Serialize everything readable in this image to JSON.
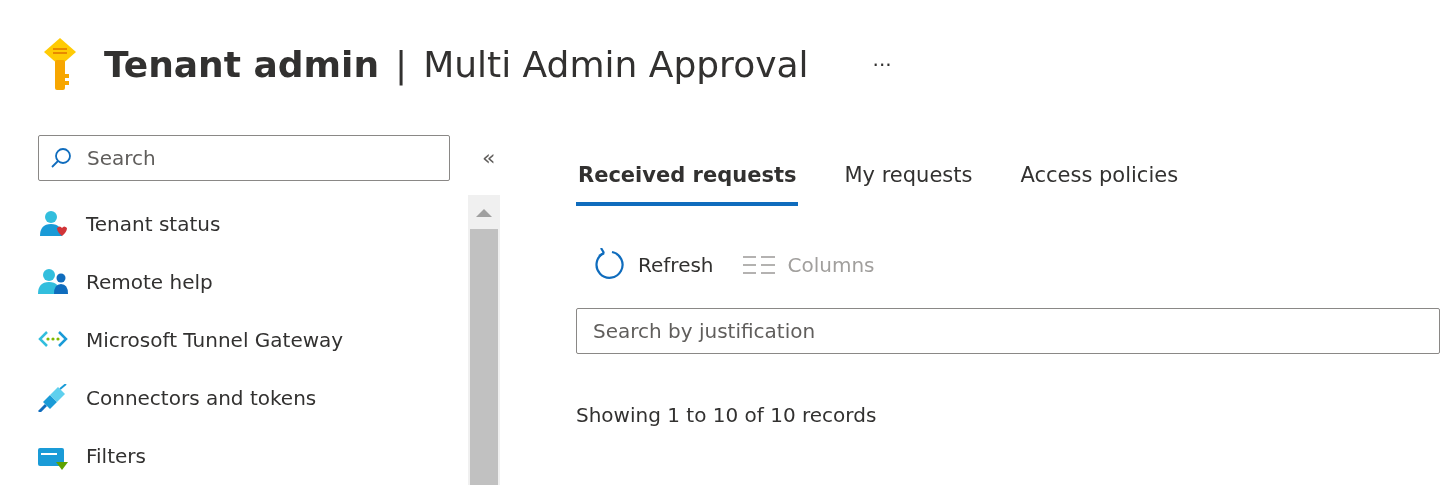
{
  "header": {
    "title_bold": "Tenant admin",
    "separator": "|",
    "title": "Multi Admin Approval",
    "more": "···"
  },
  "sidebar": {
    "search": {
      "placeholder": "Search"
    },
    "collapse": "«",
    "items": [
      {
        "label": "Tenant status",
        "kind": "person-heart"
      },
      {
        "label": "Remote help",
        "kind": "people"
      },
      {
        "label": "Microsoft Tunnel Gateway",
        "kind": "code-dots"
      },
      {
        "label": "Connectors and tokens",
        "kind": "plug"
      },
      {
        "label": "Filters",
        "kind": "filter-list"
      }
    ]
  },
  "tabs": [
    {
      "label": "Received requests",
      "selected": true
    },
    {
      "label": "My requests",
      "selected": false
    },
    {
      "label": "Access policies",
      "selected": false
    }
  ],
  "toolbar": [
    {
      "label": "Refresh",
      "kind": "refresh",
      "disabled": false
    },
    {
      "label": "Columns",
      "kind": "columns",
      "disabled": true
    }
  ],
  "filter": {
    "placeholder": "Search by justification"
  },
  "status": "Showing 1 to 10 of 10 records"
}
